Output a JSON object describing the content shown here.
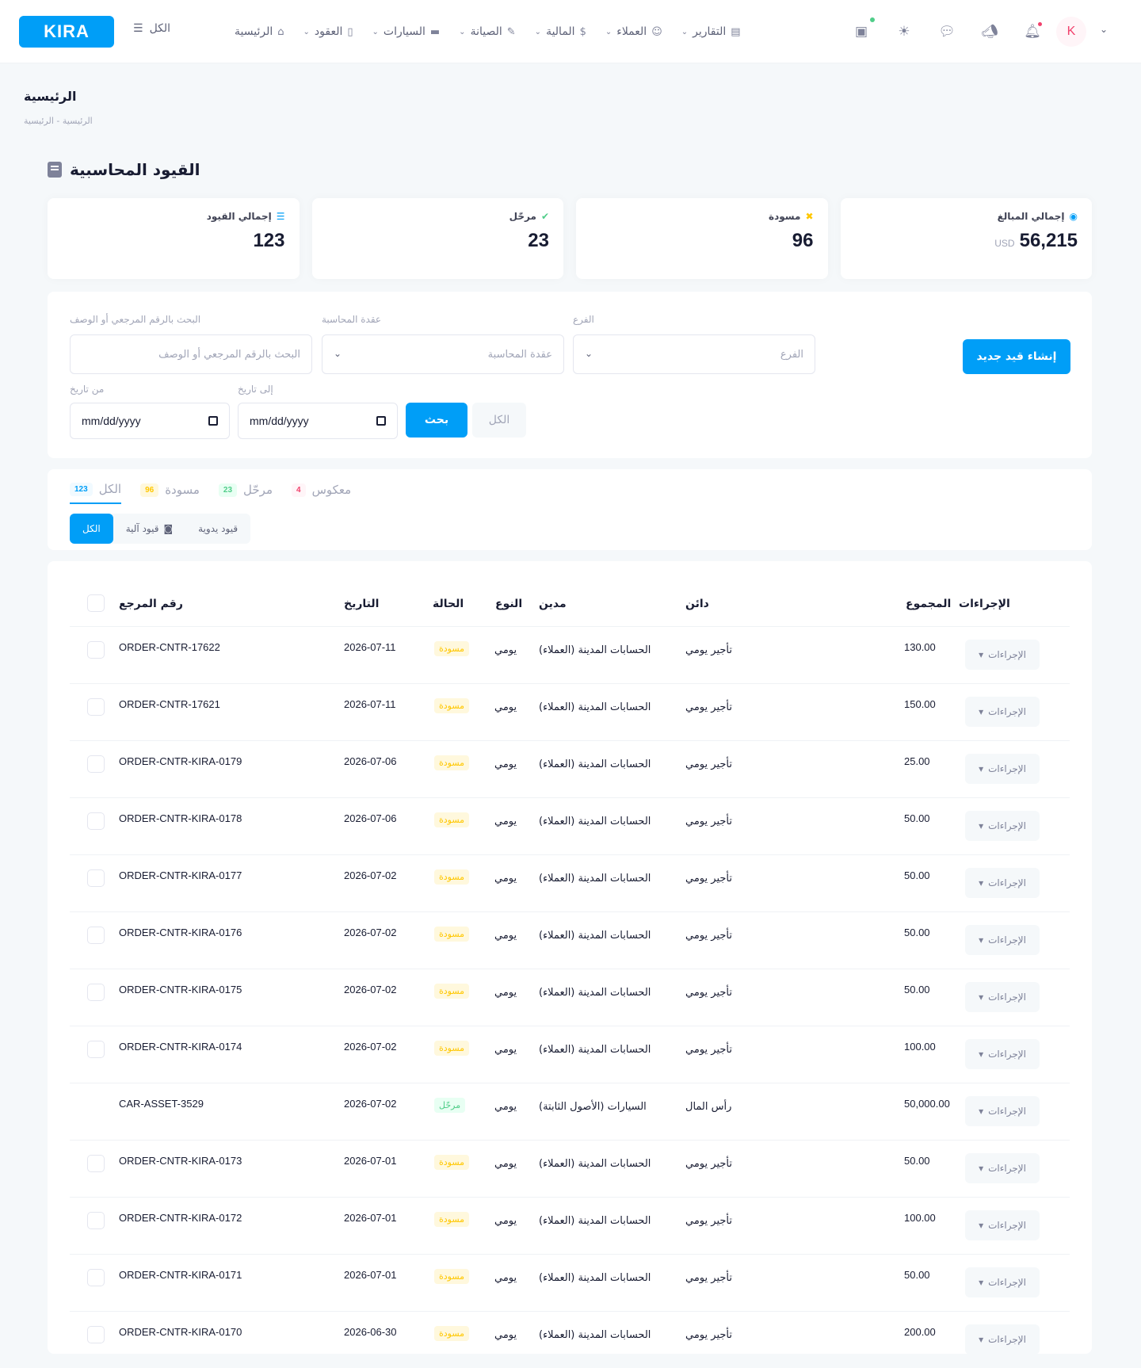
{
  "header": {
    "logo": "KIRA",
    "menu_toggle": "الكل",
    "nav": [
      {
        "label": "الرئيسية",
        "icon": "home-icon",
        "glyph": "⌂",
        "dropdown": false
      },
      {
        "label": "العقود",
        "icon": "document-icon",
        "glyph": "▯",
        "dropdown": true
      },
      {
        "label": "السيارات",
        "icon": "car-icon",
        "glyph": "▬",
        "dropdown": true
      },
      {
        "label": "الصيانة",
        "icon": "wrench-icon",
        "glyph": "✎",
        "dropdown": true
      },
      {
        "label": "المالية",
        "icon": "dollar-icon",
        "glyph": "$",
        "dropdown": true
      },
      {
        "label": "العملاء",
        "icon": "users-icon",
        "glyph": "☺",
        "dropdown": true
      },
      {
        "label": "التقارير",
        "icon": "report-icon",
        "glyph": "▤",
        "dropdown": true
      }
    ],
    "avatar_letter": "K"
  },
  "page": {
    "title": "الرئيسية",
    "breadcrumb": "الرئيسية - الرئيسية",
    "section_title": "القيود المحاسبية"
  },
  "stats": [
    {
      "label": "إجمالي القيود",
      "value": "123",
      "currency": "",
      "icon": "list-icon",
      "glyph": "☰",
      "color": "#009ef7"
    },
    {
      "label": "مرحّل",
      "value": "23",
      "currency": "",
      "icon": "check-circle-icon",
      "glyph": "✔",
      "color": "#50cd89"
    },
    {
      "label": "مسودة",
      "value": "96",
      "currency": "",
      "icon": "pencil-ruler-icon",
      "glyph": "✖",
      "color": "#ffc700"
    },
    {
      "label": "إجمالي المبالغ",
      "value": "56,215",
      "currency": "USD",
      "icon": "coins-icon",
      "glyph": "◉",
      "color": "#009ef7"
    }
  ],
  "filters": {
    "search_label": "البحث بالرقم المرجعي أو الوصف",
    "search_placeholder": "البحث بالرقم المرجعي أو الوصف",
    "contract_label": "عقدة المحاسبة",
    "contract_placeholder": "عقدة المحاسبة",
    "branch_label": "الفرع",
    "branch_placeholder": "الفرع",
    "create_button": "إنشاء قيد جديد",
    "from_label": "من تاريخ",
    "to_label": "إلى تاريخ",
    "date_placeholder": "mm/dd/yyyy",
    "search_button": "بحث",
    "all_button": "الكل"
  },
  "tabs": [
    {
      "label": "الكل",
      "count": "123",
      "badge": "b-blue",
      "active": true
    },
    {
      "label": "مسودة",
      "count": "96",
      "badge": "b-yellow",
      "active": false
    },
    {
      "label": "مرحّل",
      "count": "23",
      "badge": "b-green",
      "active": false
    },
    {
      "label": "معكوس",
      "count": "4",
      "badge": "b-red",
      "active": false
    }
  ],
  "segments": {
    "all": "الكل",
    "auto": "قيود آلية",
    "manual": "قيود يدوية"
  },
  "table": {
    "headers": {
      "ref": "رقم المرجع",
      "date": "التاريخ",
      "status": "الحالة",
      "type": "النوع",
      "debit": "مدين",
      "credit": "دائن",
      "total": "المجموع",
      "actions": "الإجراءات"
    },
    "action_label": "الإجراءات",
    "rows": [
      {
        "ref": "ORDER-CNTR-17622",
        "date": "2026-07-11",
        "status": "مسودة",
        "type": "يومي",
        "debit": "الحسابات المدينة (العملاء)",
        "credit": "تأجير يومي",
        "total": "130.00",
        "checkbox": true
      },
      {
        "ref": "ORDER-CNTR-17621",
        "date": "2026-07-11",
        "status": "مسودة",
        "type": "يومي",
        "debit": "الحسابات المدينة (العملاء)",
        "credit": "تأجير يومي",
        "total": "150.00",
        "checkbox": true
      },
      {
        "ref": "ORDER-CNTR-KIRA-0179",
        "date": "2026-07-06",
        "status": "مسودة",
        "type": "يومي",
        "debit": "الحسابات المدينة (العملاء)",
        "credit": "تأجير يومي",
        "total": "25.00",
        "checkbox": true
      },
      {
        "ref": "ORDER-CNTR-KIRA-0178",
        "date": "2026-07-06",
        "status": "مسودة",
        "type": "يومي",
        "debit": "الحسابات المدينة (العملاء)",
        "credit": "تأجير يومي",
        "total": "50.00",
        "checkbox": true
      },
      {
        "ref": "ORDER-CNTR-KIRA-0177",
        "date": "2026-07-02",
        "status": "مسودة",
        "type": "يومي",
        "debit": "الحسابات المدينة (العملاء)",
        "credit": "تأجير يومي",
        "total": "50.00",
        "checkbox": true
      },
      {
        "ref": "ORDER-CNTR-KIRA-0176",
        "date": "2026-07-02",
        "status": "مسودة",
        "type": "يومي",
        "debit": "الحسابات المدينة (العملاء)",
        "credit": "تأجير يومي",
        "total": "50.00",
        "checkbox": true
      },
      {
        "ref": "ORDER-CNTR-KIRA-0175",
        "date": "2026-07-02",
        "status": "مسودة",
        "type": "يومي",
        "debit": "الحسابات المدينة (العملاء)",
        "credit": "تأجير يومي",
        "total": "50.00",
        "checkbox": true
      },
      {
        "ref": "ORDER-CNTR-KIRA-0174",
        "date": "2026-07-02",
        "status": "مسودة",
        "type": "يومي",
        "debit": "الحسابات المدينة (العملاء)",
        "credit": "تأجير يومي",
        "total": "100.00",
        "checkbox": true
      },
      {
        "ref": "CAR-ASSET-3529",
        "date": "2026-07-02",
        "status": "مرحّل",
        "type": "يومي",
        "debit": "السيارات (الأصول الثابتة)",
        "credit": "رأس المال",
        "total": "50,000.00",
        "checkbox": false
      },
      {
        "ref": "ORDER-CNTR-KIRA-0173",
        "date": "2026-07-01",
        "status": "مسودة",
        "type": "يومي",
        "debit": "الحسابات المدينة (العملاء)",
        "credit": "تأجير يومي",
        "total": "50.00",
        "checkbox": true
      },
      {
        "ref": "ORDER-CNTR-KIRA-0172",
        "date": "2026-07-01",
        "status": "مسودة",
        "type": "يومي",
        "debit": "الحسابات المدينة (العملاء)",
        "credit": "تأجير يومي",
        "total": "100.00",
        "checkbox": true
      },
      {
        "ref": "ORDER-CNTR-KIRA-0171",
        "date": "2026-07-01",
        "status": "مسودة",
        "type": "يومي",
        "debit": "الحسابات المدينة (العملاء)",
        "credit": "تأجير يومي",
        "total": "50.00",
        "checkbox": true
      },
      {
        "ref": "ORDER-CNTR-KIRA-0170",
        "date": "2026-06-30",
        "status": "مسودة",
        "type": "يومي",
        "debit": "الحسابات المدينة (العملاء)",
        "credit": "تأجير يومي",
        "total": "200.00",
        "checkbox": true
      }
    ]
  }
}
